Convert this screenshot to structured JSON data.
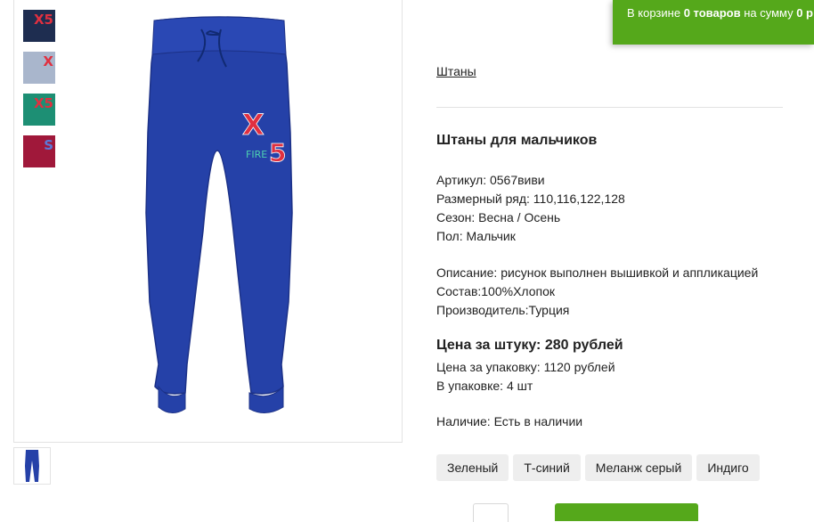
{
  "cart": {
    "prefix": "В корзине ",
    "count": "0 товаров",
    "middle": " на сумму ",
    "sum": "0 р"
  },
  "gallery": {
    "thumbnails": [
      {
        "name": "thumb-navy",
        "color": "#1e2d50"
      },
      {
        "name": "thumb-melange",
        "color": "#a9b6cc"
      },
      {
        "name": "thumb-green",
        "color": "#1d8f74"
      },
      {
        "name": "thumb-burgundy",
        "color": "#a0183a"
      }
    ],
    "main_color": "#2541a8",
    "patch_text": "FIRE"
  },
  "product": {
    "breadcrumb": "Штаны",
    "title": "Штаны для мальчиков",
    "article": "Артикул: 0567виви",
    "sizes": "Размерный ряд: 110,116,122,128",
    "season": "Сезон: Весна / Осень",
    "gender": "Пол: Мальчик",
    "description": "Описание: рисунок выполнен вышивкой и аппликацией",
    "composition": "Состав:100%Хлопок",
    "manufacturer": "Производитель:Турция",
    "price_unit": "Цена за штуку: 280 рублей",
    "price_pack": "Цена за упаковку: 1120 рублей",
    "pack_qty": "В упаковке: 4 шт",
    "stock": "Наличие: Есть в наличии"
  },
  "colors": [
    "Зеленый",
    "Т-синий",
    "Меланж серый",
    "Индиго"
  ],
  "accent": "#55a81b"
}
